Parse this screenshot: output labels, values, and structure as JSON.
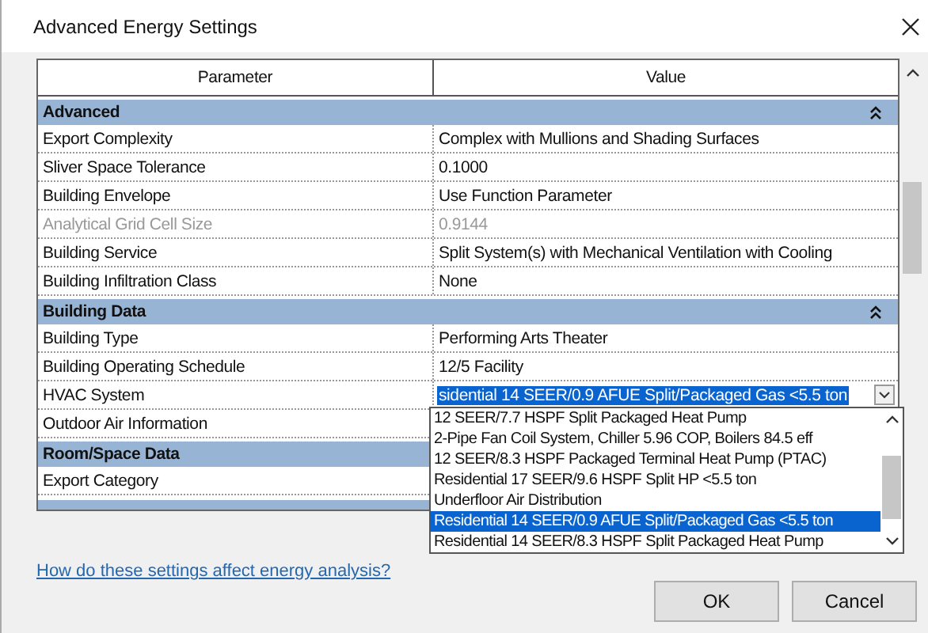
{
  "window": {
    "title": "Advanced Energy Settings"
  },
  "table": {
    "columns": [
      "Parameter",
      "Value"
    ],
    "groups": [
      {
        "name": "Advanced",
        "expanded": true,
        "rows": [
          {
            "parameter": "Export Complexity",
            "value": "Complex with Mullions and Shading Surfaces",
            "disabled": false,
            "kind": "text"
          },
          {
            "parameter": "Sliver Space Tolerance",
            "value": "0.1000",
            "disabled": false,
            "kind": "text"
          },
          {
            "parameter": "Building Envelope",
            "value": "Use Function Parameter",
            "disabled": false,
            "kind": "text"
          },
          {
            "parameter": "Analytical Grid Cell Size",
            "value": "0.9144",
            "disabled": true,
            "kind": "text"
          },
          {
            "parameter": "Building Service",
            "value": "Split System(s) with Mechanical Ventilation with Cooling",
            "disabled": false,
            "kind": "text"
          },
          {
            "parameter": "Building Infiltration Class",
            "value": "None",
            "disabled": false,
            "kind": "text"
          }
        ]
      },
      {
        "name": "Building Data",
        "expanded": true,
        "rows": [
          {
            "parameter": "Building Type",
            "value": "Performing Arts Theater",
            "disabled": false,
            "kind": "text"
          },
          {
            "parameter": "Building Operating Schedule",
            "value": "12/5 Facility",
            "disabled": false,
            "kind": "text"
          },
          {
            "parameter": "HVAC System",
            "value": "sidential 14 SEER/0.9 AFUE Split/Packaged Gas <5.5 ton",
            "disabled": false,
            "kind": "combo"
          },
          {
            "parameter": "Outdoor Air Information",
            "disabled": false,
            "kind": "text"
          }
        ]
      },
      {
        "name": "Room/Space Data",
        "rows": [
          {
            "parameter": "Export Category",
            "disabled": false,
            "kind": "text"
          }
        ]
      }
    ]
  },
  "dropdown": {
    "items": [
      {
        "label": "12 SEER/7.7 HSPF Split Packaged Heat Pump",
        "selected": false
      },
      {
        "label": "2-Pipe Fan Coil System, Chiller 5.96 COP, Boilers 84.5 eff",
        "selected": false
      },
      {
        "label": "12 SEER/8.3 HSPF Packaged Terminal Heat Pump (PTAC)",
        "selected": false
      },
      {
        "label": "Residential 17 SEER/9.6 HSPF Split HP <5.5 ton",
        "selected": false
      },
      {
        "label": "Underfloor Air Distribution",
        "selected": false
      },
      {
        "label": "Residential 14 SEER/0.9 AFUE Split/Packaged Gas <5.5 ton",
        "selected": true
      },
      {
        "label": "Residential 14 SEER/8.3 HSPF Split Packaged Heat Pump",
        "selected": false
      }
    ]
  },
  "link": "How do these settings affect energy analysis?",
  "buttons": [
    "OK",
    "Cancel"
  ]
}
